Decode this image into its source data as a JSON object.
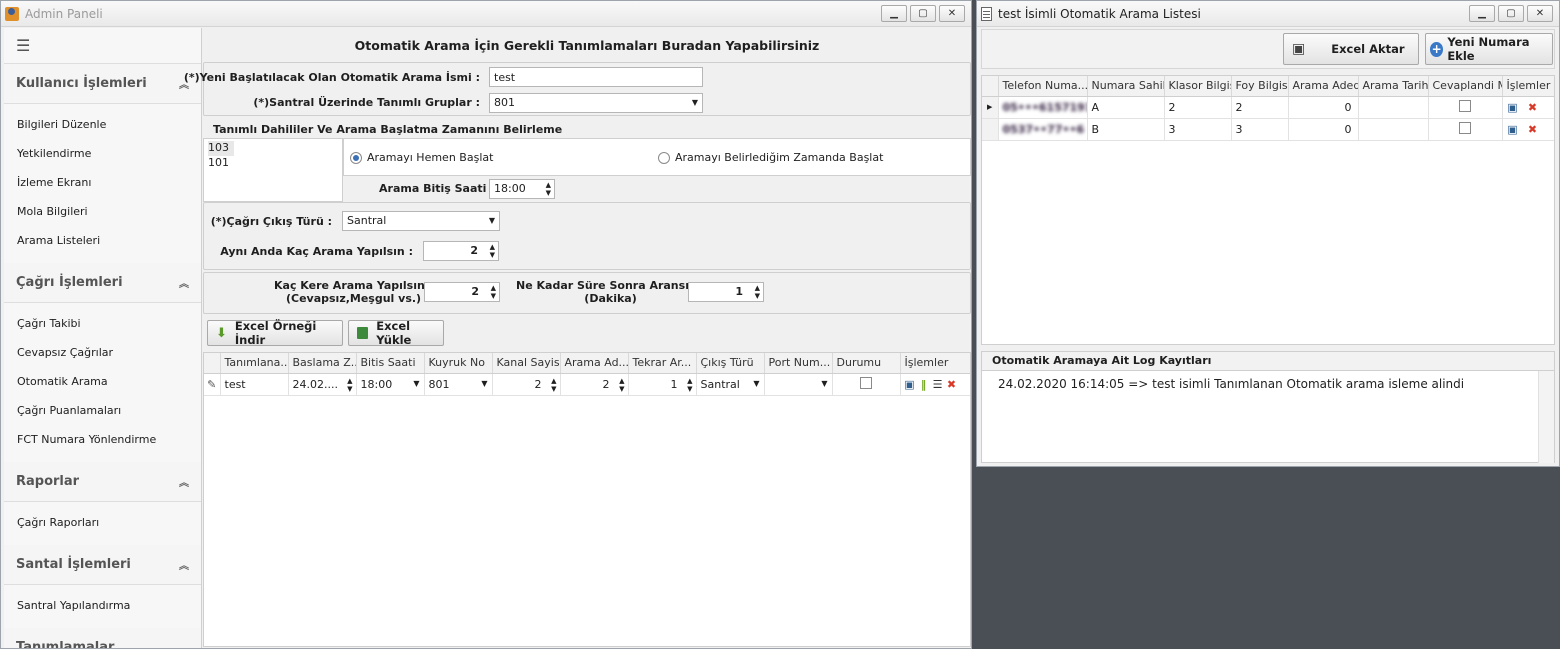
{
  "main_window": {
    "title": "Admin Paneli"
  },
  "list_window": {
    "title": "test İsimli Otomatik Arama Listesi"
  },
  "sidebar": {
    "groups": [
      {
        "title": "Kullanıcı İşlemleri",
        "items": [
          "Bilgileri Düzenle",
          "Yetkilendirme",
          "İzleme Ekranı",
          "Mola Bilgileri",
          "Arama Listeleri"
        ]
      },
      {
        "title": "Çağrı İşlemleri",
        "items": [
          "Çağrı Takibi",
          "Cevapsız Çağrılar",
          "Otomatik Arama",
          "Çağrı Puanlamaları",
          "FCT Numara Yönlendirme"
        ]
      },
      {
        "title": "Raporlar",
        "items": [
          "Çağrı Raporları"
        ]
      },
      {
        "title": "Santal İşlemleri",
        "items": [
          "Santral Yapılandırma"
        ]
      },
      {
        "title": "Tanımlamalar",
        "items": []
      }
    ]
  },
  "form": {
    "page_title": "Otomatik Arama İçin Gerekli Tanımlamaları Buradan Yapabilirsiniz",
    "name_label": "(*)Yeni Başlatılacak Olan Otomatik Arama İsmi :",
    "name_value": "test",
    "groups_label": "(*)Santral Üzerinde Tanımlı Gruplar :",
    "groups_value": "801",
    "section_title": "Tanımlı Dahililer Ve Arama Başlatma Zamanını Belirleme",
    "extensions": [
      "103",
      "101"
    ],
    "radio_now": "Aramayı Hemen Başlat",
    "radio_scheduled": "Aramayı Belirlediğim Zamanda Başlat",
    "end_time_label": "Arama Bitiş Saati :",
    "end_time_value": "18:00",
    "call_type_label": "(*)Çağrı Çıkış Türü :",
    "call_type_value": "Santral",
    "concurrent_label": "Aynı Anda Kaç Arama Yapılsın :",
    "concurrent_value": "2",
    "retry_label_1": "Kaç Kere Arama Yapılsın :",
    "retry_label_2": "(Cevapsız,Meşgul vs.)",
    "retry_value": "2",
    "delay_label_1": "Ne Kadar Süre Sonra Aransın :",
    "delay_label_2": "(Dakika)",
    "delay_value": "1",
    "btn_download": "Excel Örneği İndir",
    "btn_upload": "Excel Yükle"
  },
  "main_grid": {
    "columns": [
      "Tanımlana...",
      "Baslama Z...",
      "Bitis Saati",
      "Kuyruk No",
      "Kanal Sayisi",
      "Arama Ad...",
      "Tekrar Ar...",
      "Çıkış Türü",
      "Port Num...",
      "Durumu",
      "İşlemler"
    ],
    "row": {
      "name": "test",
      "start": "24.02....",
      "end": "18:00",
      "queue": "801",
      "channels": "2",
      "calls": "2",
      "retry": "1",
      "type": "Santral"
    }
  },
  "list": {
    "btn_excel": "Excel Aktar",
    "btn_add": "Yeni Numara Ekle",
    "columns": [
      "Telefon Numa...",
      "Numara Sahibi",
      "Klasor Bilgisi",
      "Foy Bilgisi",
      "Arama Adedi",
      "Arama Tarihi",
      "Cevaplandi Mi",
      "İşlemler"
    ],
    "rows": [
      {
        "phone": "05•••6157191",
        "owner": "A",
        "klasor": "2",
        "foy": "2",
        "count": "0"
      },
      {
        "phone": "0537••77••6",
        "owner": "B",
        "klasor": "3",
        "foy": "3",
        "count": "0"
      }
    ]
  },
  "log": {
    "title": "Otomatik Aramaya Ait Log Kayıtları",
    "entry": "24.02.2020 16:14:05  =>  test isimli Tanımlanan  Otomatik arama isleme alindi"
  }
}
